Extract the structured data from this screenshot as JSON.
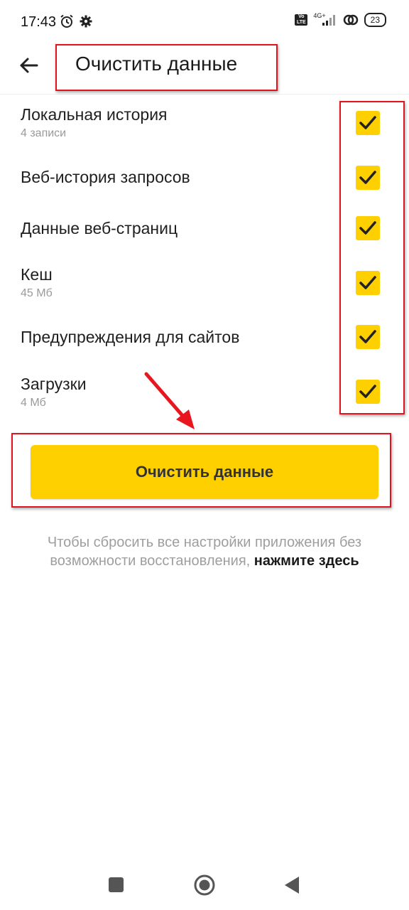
{
  "status_bar": {
    "time": "17:43",
    "volte_line1": "Vo",
    "volte_line2": "LTE",
    "network": "4G+",
    "battery": "23",
    "icons": [
      "alarm-icon",
      "gear-icon",
      "signal-icon",
      "link-icon",
      "battery-icon"
    ]
  },
  "app_bar": {
    "title": "Очистить данные",
    "back_icon": "arrow-left-icon"
  },
  "options": [
    {
      "label": "Локальная история",
      "sub": "4 записи",
      "checked": true
    },
    {
      "label": "Веб-история запросов",
      "sub": "",
      "checked": true
    },
    {
      "label": "Данные веб-страниц",
      "sub": "",
      "checked": true
    },
    {
      "label": "Кеш",
      "sub": "45 Мб",
      "checked": true
    },
    {
      "label": "Предупреждения для сайтов",
      "sub": "",
      "checked": true
    },
    {
      "label": "Загрузки",
      "sub": "4 Мб",
      "checked": true
    }
  ],
  "clear_button": {
    "label": "Очистить данные"
  },
  "reset_notice": {
    "text": "Чтобы сбросить все настройки приложения без возможности восстановления, ",
    "link": "нажмите здесь"
  },
  "colors": {
    "accent": "#ffd000",
    "highlight": "#e0141f",
    "muted_text": "#9e9e9e"
  },
  "nav_bar": {
    "icons": [
      "recents-square-icon",
      "home-circle-icon",
      "back-triangle-icon"
    ]
  }
}
